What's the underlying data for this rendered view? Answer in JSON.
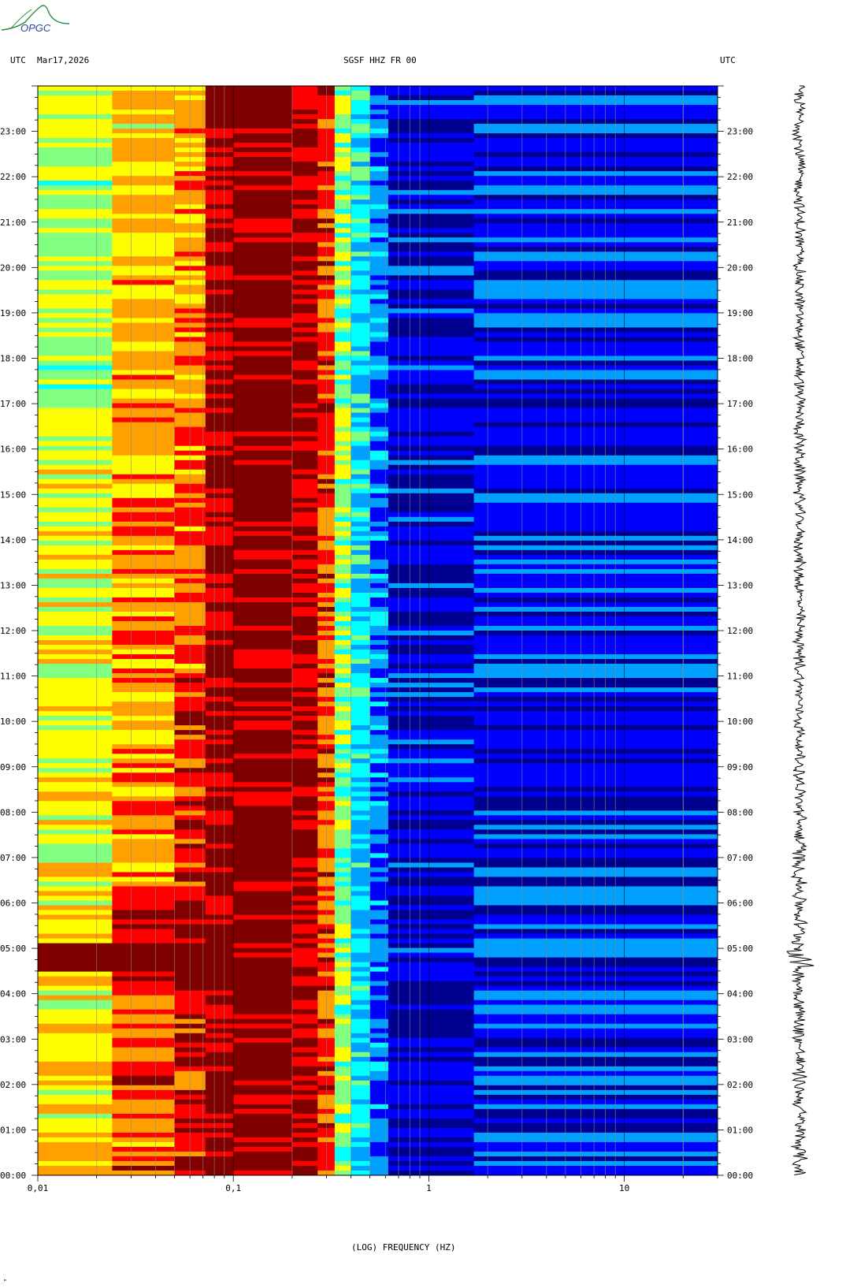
{
  "logo": {
    "text": "OPGC"
  },
  "header": {
    "left_tz": "UTC",
    "date": "Mar17,2026",
    "station": "SGSF HHZ FR 00",
    "right_tz": "UTC"
  },
  "chart_data": {
    "type": "heatmap",
    "title": "SGSF HHZ FR 00",
    "xlabel": "(LOG) FREQUENCY (HZ)",
    "ylabel": "UTC",
    "x_scale": "log",
    "xlim": [
      0.01,
      30
    ],
    "x_ticks": [
      "0,01",
      "0,1",
      "1",
      "10"
    ],
    "x_tick_values": [
      0.01,
      0.1,
      1,
      10
    ],
    "y_ticks": [
      "00:00",
      "01:00",
      "02:00",
      "03:00",
      "04:00",
      "05:00",
      "06:00",
      "07:00",
      "08:00",
      "09:00",
      "10:00",
      "11:00",
      "12:00",
      "13:00",
      "14:00",
      "15:00",
      "16:00",
      "17:00",
      "18:00",
      "19:00",
      "20:00",
      "21:00",
      "22:00",
      "23:00"
    ],
    "ylim_hours": [
      0,
      24
    ],
    "colormap": [
      "#000090",
      "#0000ff",
      "#00a0ff",
      "#00ffff",
      "#80ff80",
      "#ffff00",
      "#ffa000",
      "#ff0000",
      "#800000"
    ],
    "spectral_bands": [
      {
        "f_min": 0.01,
        "f_max": 0.024,
        "level_early": 5.4,
        "level_late": 4.2
      },
      {
        "f_min": 0.024,
        "f_max": 0.05,
        "level_early": 6.6,
        "level_late": 5.4
      },
      {
        "f_min": 0.05,
        "f_max": 0.072,
        "level_early": 7.2,
        "level_late": 5.8
      },
      {
        "f_min": 0.072,
        "f_max": 0.1,
        "level_early": 8.0,
        "level_late": 7.6
      },
      {
        "f_min": 0.1,
        "f_max": 0.2,
        "level_early": 8.0,
        "level_late": 8.0
      },
      {
        "f_min": 0.2,
        "f_max": 0.27,
        "level_early": 7.7,
        "level_late": 7.6
      },
      {
        "f_min": 0.27,
        "f_max": 0.33,
        "level_early": 6.6,
        "level_late": 6.8
      },
      {
        "f_min": 0.33,
        "f_max": 0.4,
        "level_early": 4.0,
        "level_late": 4.3
      },
      {
        "f_min": 0.4,
        "f_max": 0.5,
        "level_early": 2.6,
        "level_late": 2.9
      },
      {
        "f_min": 0.5,
        "f_max": 0.62,
        "level_early": 1.6,
        "level_late": 1.8
      },
      {
        "f_min": 0.62,
        "f_max": 1.7,
        "level_early": 0.5,
        "level_late": 0.5
      },
      {
        "f_min": 1.7,
        "f_max": 30,
        "level_early": 0.9,
        "level_late": 0.9
      }
    ],
    "event_hour": 4.8
  }
}
